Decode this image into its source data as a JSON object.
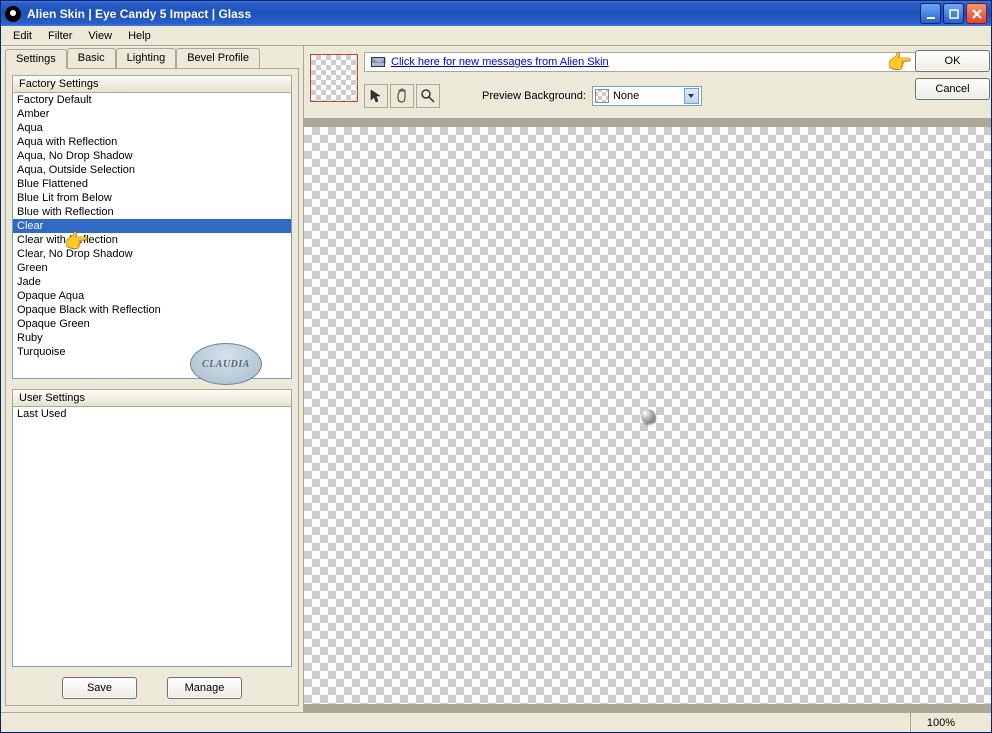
{
  "window": {
    "title": "Alien Skin  |  Eye Candy 5 Impact  |  Glass"
  },
  "menu": {
    "items": [
      "Edit",
      "Filter",
      "View",
      "Help"
    ]
  },
  "tabs": [
    "Settings",
    "Basic",
    "Lighting",
    "Bevel Profile"
  ],
  "active_tab": 0,
  "factory": {
    "header": "Factory Settings",
    "items": [
      "Factory Default",
      "Amber",
      "Aqua",
      "Aqua with Reflection",
      "Aqua, No Drop Shadow",
      "Aqua, Outside Selection",
      "Blue Flattened",
      "Blue Lit from Below",
      "Blue with Reflection",
      "Clear",
      "Clear with Reflection",
      "Clear, No Drop Shadow",
      "Green",
      "Jade",
      "Opaque Aqua",
      "Opaque Black with Reflection",
      "Opaque Green",
      "Ruby",
      "Turquoise"
    ],
    "selected_index": 9
  },
  "user": {
    "header": "User Settings",
    "items": [
      "Last Used"
    ]
  },
  "buttons": {
    "save": "Save",
    "manage": "Manage",
    "ok": "OK",
    "cancel": "Cancel"
  },
  "messages": {
    "link": "Click here for new messages from Alien Skin"
  },
  "preview": {
    "bg_label": "Preview Background:",
    "bg_value": "None"
  },
  "status": {
    "zoom": "100%"
  },
  "watermark": "CLAUDIA"
}
